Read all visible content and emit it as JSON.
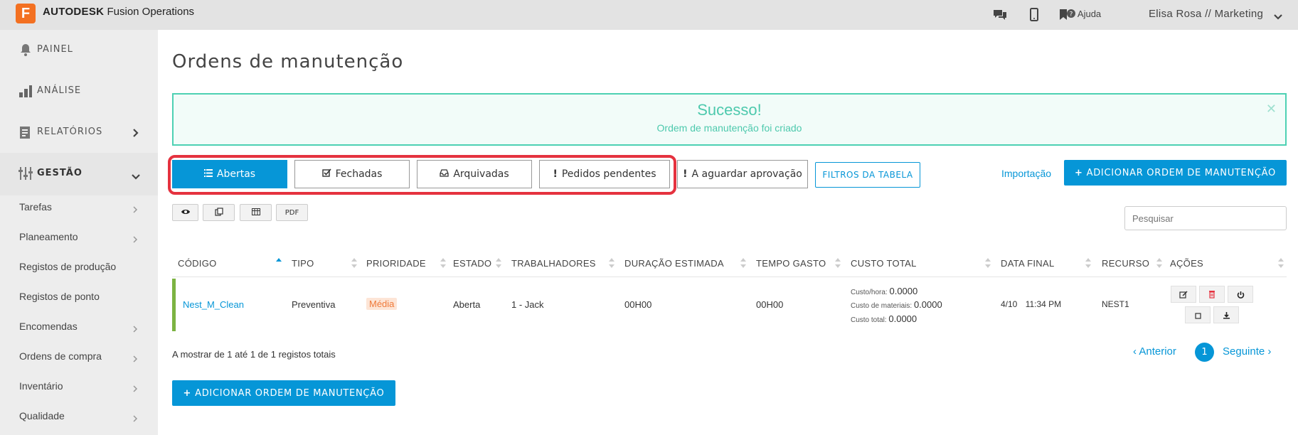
{
  "brand": {
    "logo_letter": "F",
    "company": "AUTODESK",
    "product": "Fusion Operations",
    "color": "#f37021"
  },
  "topbar": {
    "help_label": "Ajuda",
    "user_label": "Elisa Rosa // Marketing"
  },
  "sidebar": {
    "main": [
      {
        "label": "PAINEL",
        "icon": "bell-icon"
      },
      {
        "label": "ANÁLISE",
        "icon": "bar-chart-icon"
      },
      {
        "label": "RELATÓRIOS",
        "icon": "report-icon"
      },
      {
        "label": "GESTÃO",
        "icon": "sliders-icon"
      }
    ],
    "sub": [
      "Tarefas",
      "Planeamento",
      "Registos de produção",
      "Registos de ponto",
      "Encomendas",
      "Ordens de compra",
      "Inventário",
      "Qualidade"
    ]
  },
  "page": {
    "title": "Ordens de manutenção"
  },
  "alert": {
    "title": "Sucesso!",
    "message": "Ordem de manutenção foi criado",
    "color": "#4dc9ad"
  },
  "tabs": [
    "Abertas",
    "Fechadas",
    "Arquivadas",
    "Pedidos pendentes",
    "A aguardar aprovação"
  ],
  "toolbar": {
    "filters_label": "FILTROS DA TABELA",
    "import_label": "Importação",
    "add_label": "ADICIONAR ORDEM DE MANUTENÇÃO",
    "pdf_label": "PDF",
    "search_placeholder": "Pesquisar"
  },
  "table": {
    "headers": [
      "CÓDIGO",
      "TIPO",
      "PRIORIDADE",
      "ESTADO",
      "TRABALHADORES",
      "DURAÇÃO ESTIMADA",
      "TEMPO GASTO",
      "CUSTO TOTAL",
      "DATA FINAL",
      "RECURSO",
      "AÇÕES"
    ],
    "row": {
      "code": "Nest_M_Clean",
      "type": "Preventiva",
      "priority": "Média",
      "state": "Aberta",
      "workers": "1 - Jack",
      "duration": "00H00",
      "time_spent": "00H00",
      "cost_hour_label": "Custo/hora:",
      "cost_hour": "0.0000",
      "cost_materials_label": "Custo de materiais:",
      "cost_materials": "0.0000",
      "cost_total_label": "Custo total:",
      "cost_total": "0.0000",
      "end_date": "4/10",
      "end_time": "11:34 PM",
      "resource": "NEST1"
    }
  },
  "footer": {
    "showing": "A mostrar de 1 até 1 de 1 registos totais",
    "prev": "Anterior",
    "page": "1",
    "next": "Seguinte"
  },
  "colors": {
    "accent": "#0696d7",
    "highlight": "#e5323f",
    "row_status": "#7cb342"
  }
}
